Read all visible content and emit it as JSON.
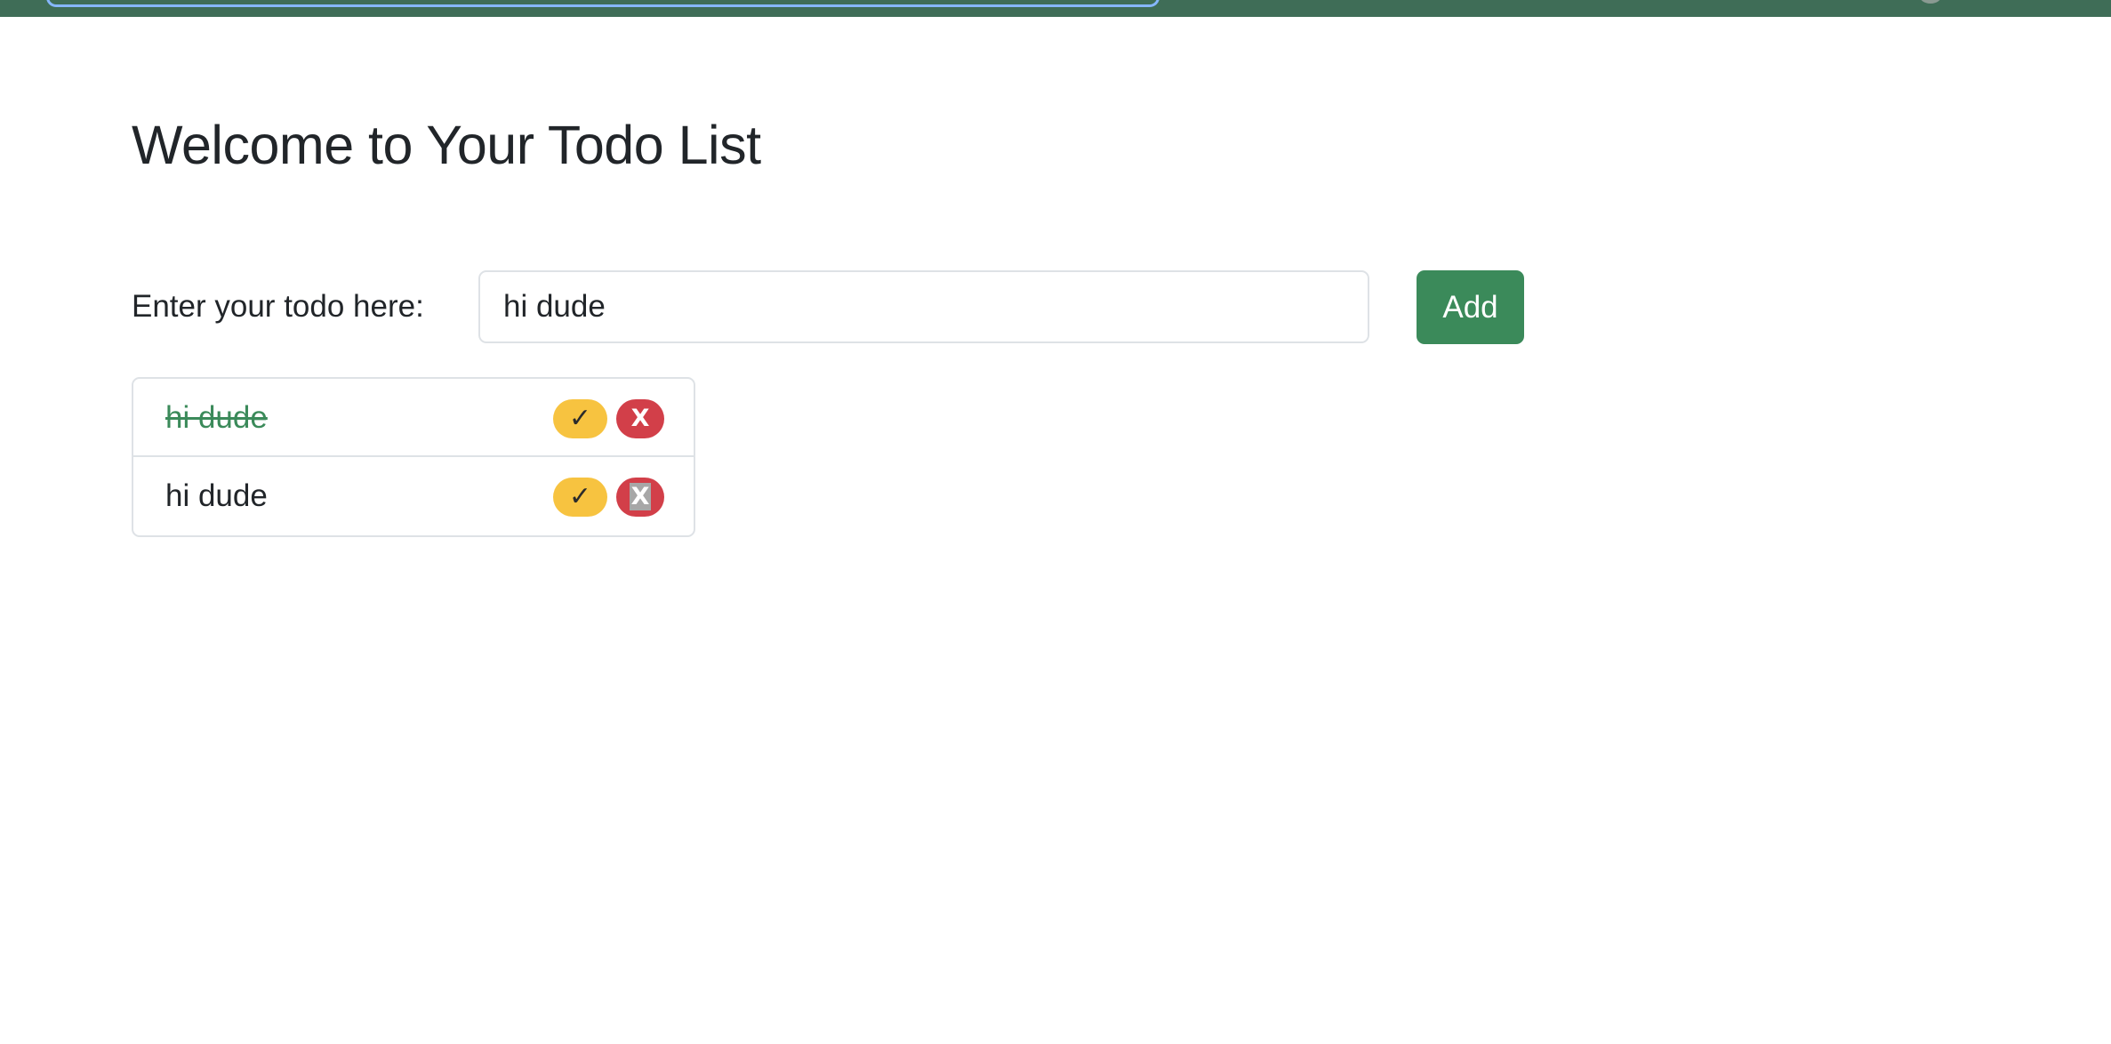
{
  "header": {
    "title": "Welcome to Your Todo List"
  },
  "form": {
    "label": "Enter your todo here:",
    "input_value": "hi dude",
    "add_label": "Add"
  },
  "todos": [
    {
      "text": "hi dude",
      "completed": true,
      "complete_icon": "✓",
      "delete_label": "X"
    },
    {
      "text": "hi dude",
      "completed": false,
      "complete_icon": "✓",
      "delete_label": "X"
    }
  ],
  "colors": {
    "topbar": "#3f6d57",
    "accent_green": "#3b8a5a",
    "warning_yellow": "#f7c340",
    "danger_red": "#d23f49"
  },
  "icons": {
    "complete": "check-icon",
    "delete": "close-icon"
  }
}
